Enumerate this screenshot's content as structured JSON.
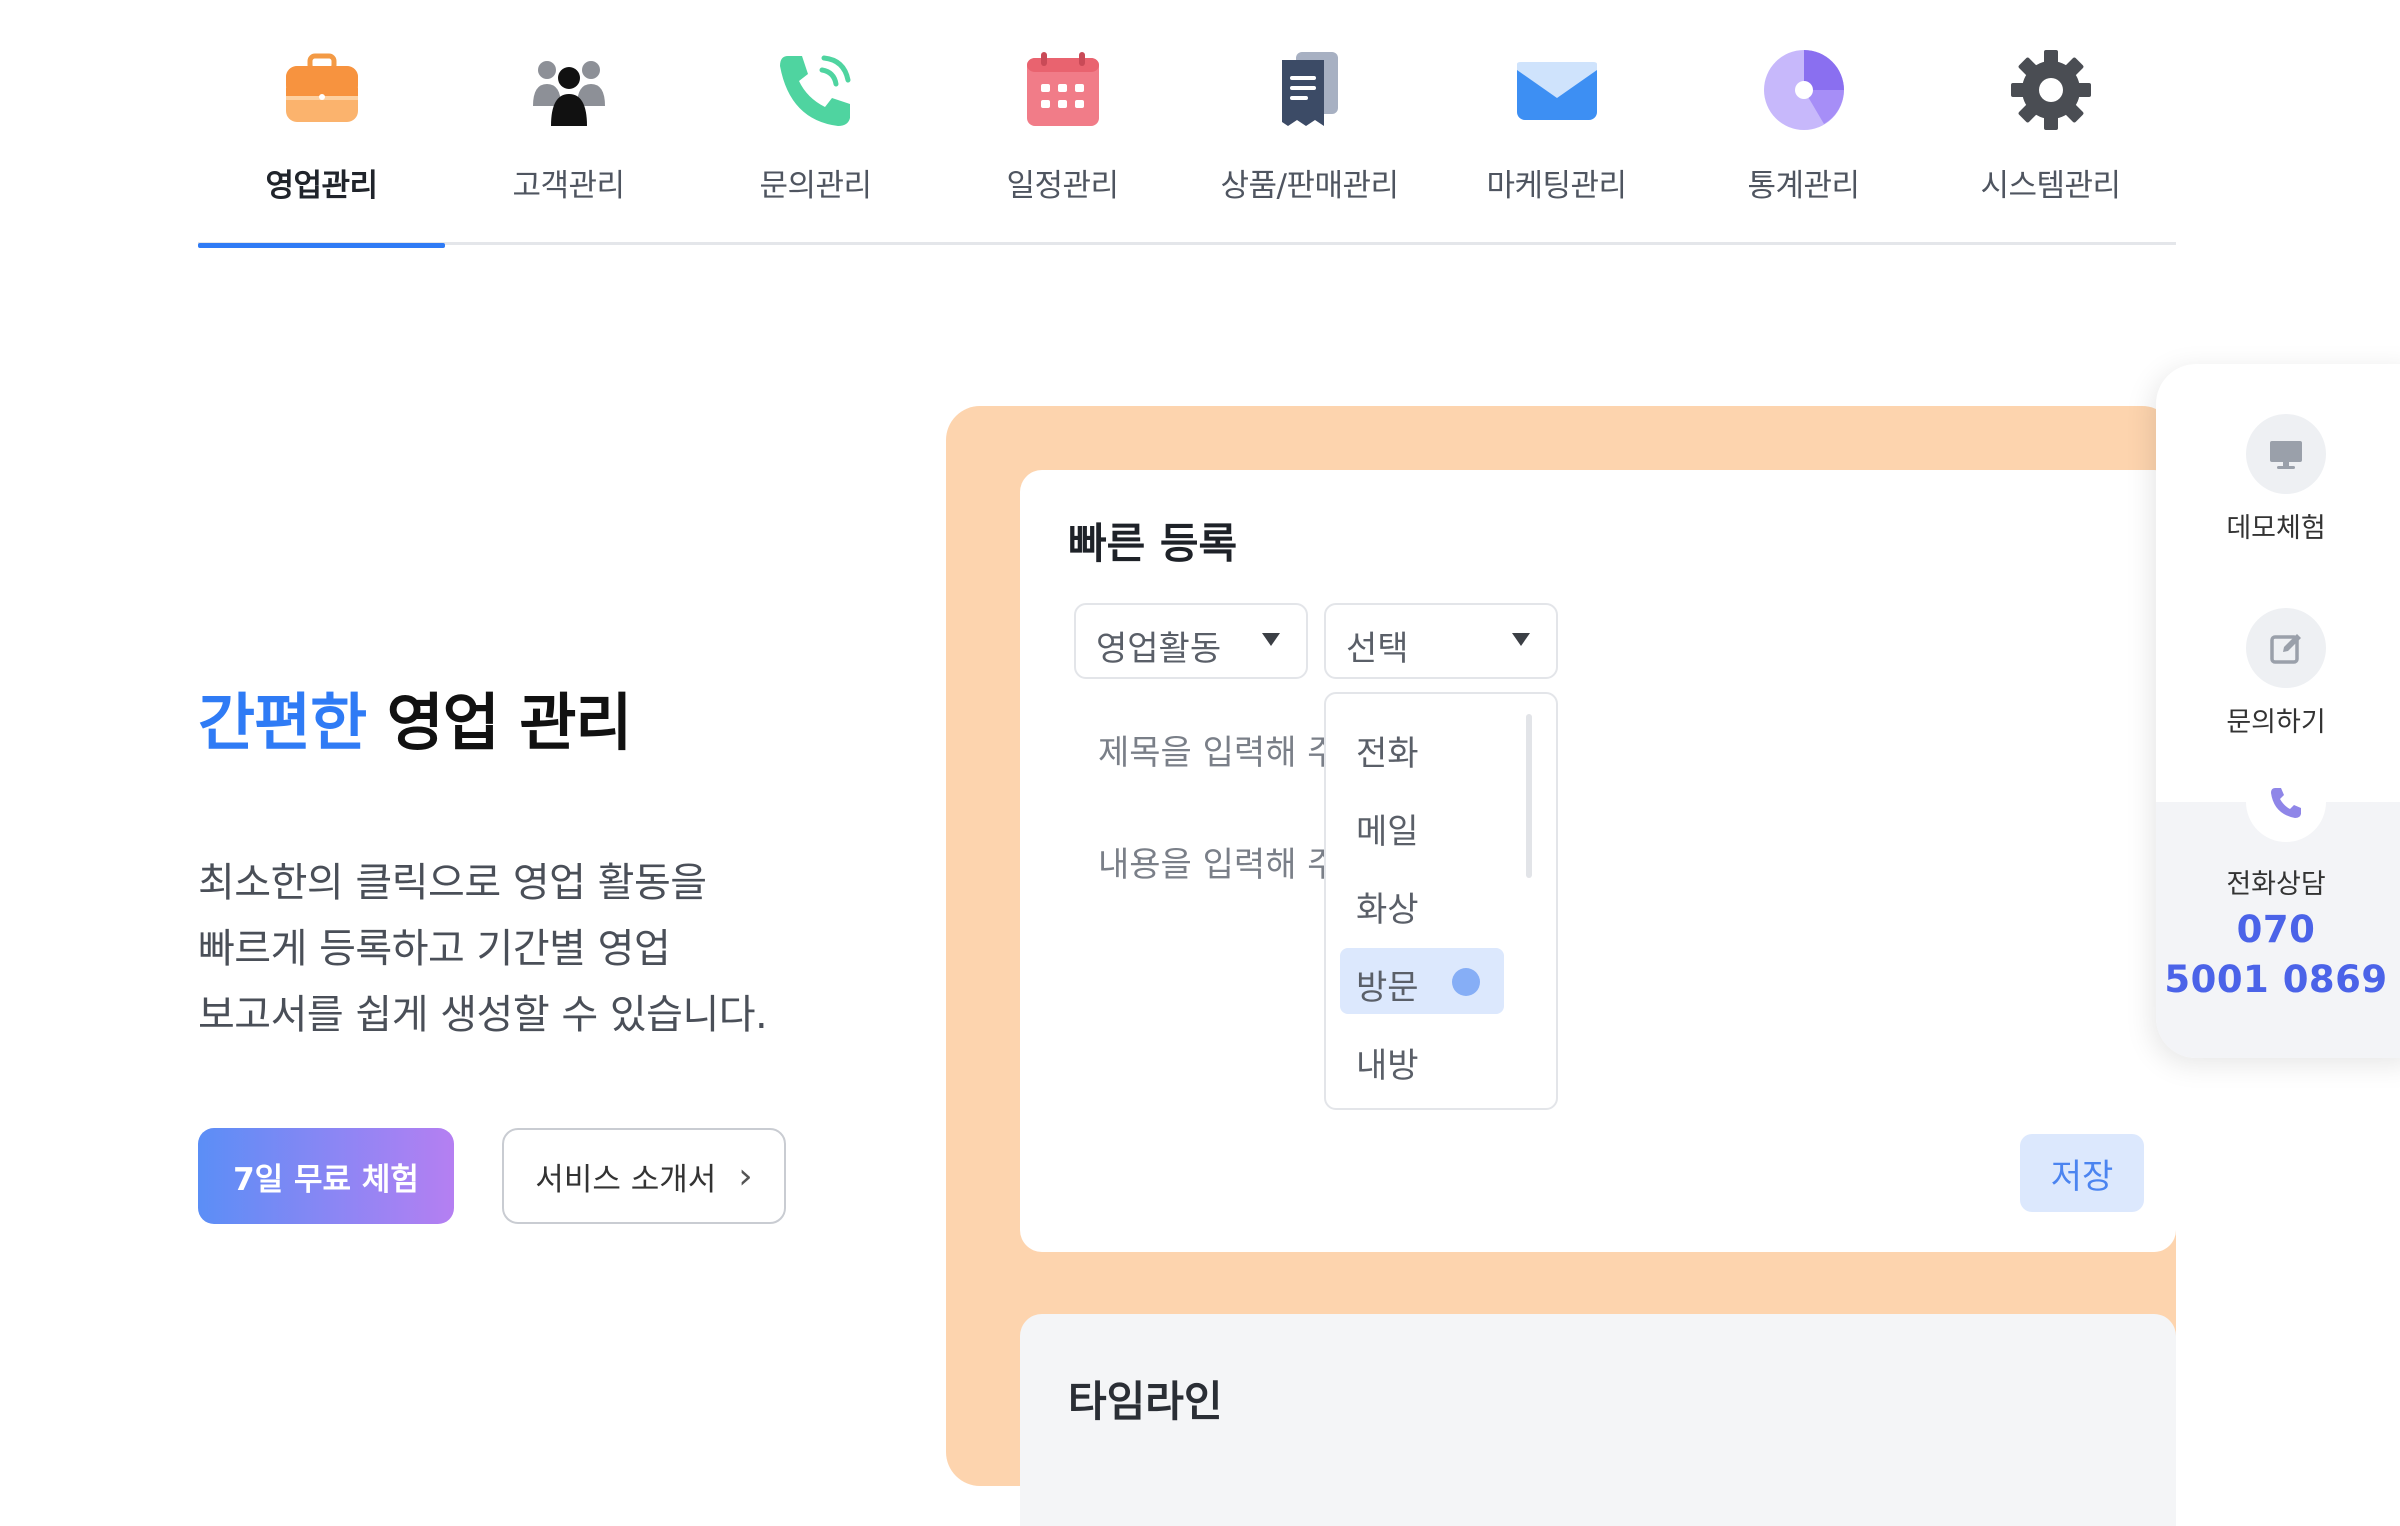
{
  "nav": {
    "tabs": [
      {
        "label": "영업관리",
        "icon": "briefcase-icon",
        "active": true
      },
      {
        "label": "고객관리",
        "icon": "users-icon",
        "active": false
      },
      {
        "label": "문의관리",
        "icon": "phone-icon",
        "active": false
      },
      {
        "label": "일정관리",
        "icon": "calendar-icon",
        "active": false
      },
      {
        "label": "상품/판매관리",
        "icon": "receipt-icon",
        "active": false
      },
      {
        "label": "마케팅관리",
        "icon": "mail-icon",
        "active": false
      },
      {
        "label": "통계관리",
        "icon": "pie-chart-icon",
        "active": false
      },
      {
        "label": "시스템관리",
        "icon": "gear-icon",
        "active": false
      }
    ],
    "active_color": "#2f7bf5"
  },
  "hero": {
    "title_accent": "간편한",
    "title_rest": " 영업 관리",
    "desc": [
      "최소한의 클릭으로 영업 활동을",
      "빠르게 등록하고 기간별 영업",
      "보고서를 쉽게 생성할 수 있습니다."
    ],
    "trial_button": "7일 무료 체험",
    "intro_button": "서비스 소개서"
  },
  "quick_register": {
    "title": "빠른 등록",
    "type_select": "영업활동",
    "kind_select": "선택",
    "title_placeholder": "제목을 입력해 주",
    "content_placeholder": "내용을 입력해 주",
    "dropdown_options": [
      "전화",
      "메일",
      "화상",
      "방문",
      "내방"
    ],
    "dropdown_selected": "방문",
    "save_button": "저장"
  },
  "timeline": {
    "title": "타임라인"
  },
  "side_panel": {
    "demo_label": "데모체험",
    "inquiry_label": "문의하기",
    "call_label": "전화상담",
    "phone_line1": "070",
    "phone_line2": "5001 0869"
  },
  "colors": {
    "peach_bg": "#fdd4ae",
    "accent_blue": "#2f7bf5",
    "gradient_start": "#5b8ef6",
    "gradient_end": "#b57ff2",
    "phone_color": "#4b63e8"
  }
}
